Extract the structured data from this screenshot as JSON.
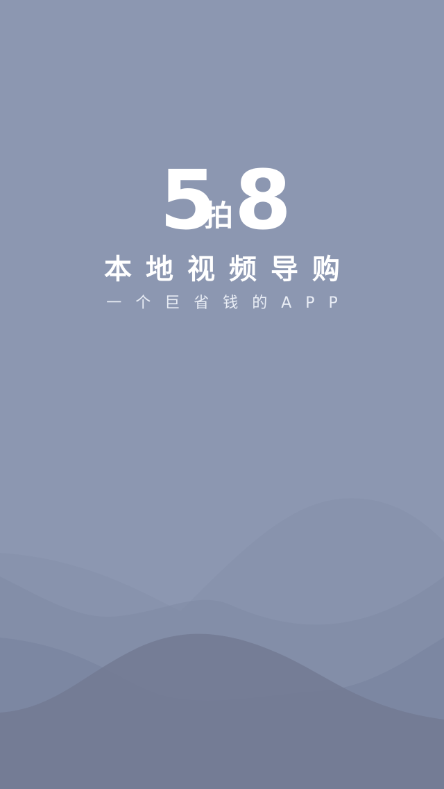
{
  "splash": {
    "logo": {
      "left_digit": "5",
      "middle_char": "拍",
      "right_digit": "8"
    },
    "tagline": "本地视频导购",
    "subline": "一个巨省钱的APP"
  },
  "colors": {
    "background": "#8c97b1",
    "text": "#ffffff",
    "wave_light": "#7f8aa4",
    "wave_mid": "#7a84a0",
    "wave_dark": "#737a93"
  }
}
